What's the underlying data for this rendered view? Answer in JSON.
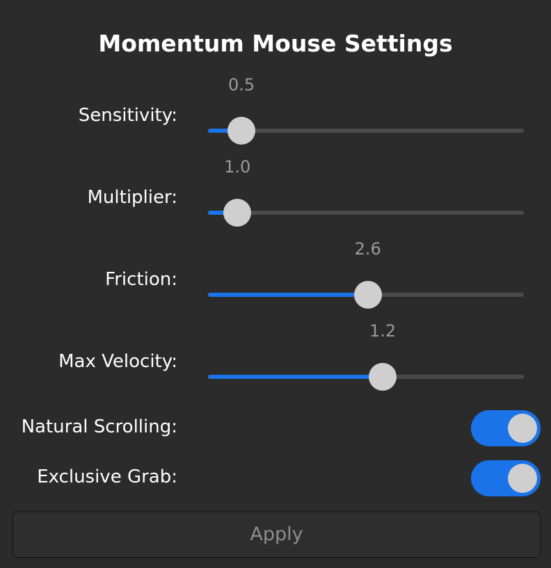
{
  "window": {
    "title": "Momentum Mouse Settings"
  },
  "sliders": [
    {
      "label": "Sensitivity:",
      "value_text": "0.5",
      "fill_fraction": 0.106
    },
    {
      "label": "Multiplier:",
      "value_text": "1.0",
      "fill_fraction": 0.093
    },
    {
      "label": "Friction:",
      "value_text": "2.6",
      "fill_fraction": 0.506
    },
    {
      "label": "Max Velocity:",
      "value_text": "1.2",
      "fill_fraction": 0.553
    }
  ],
  "toggles": [
    {
      "label": "Natural Scrolling:",
      "state": "on"
    },
    {
      "label": "Exclusive Grab:",
      "state": "on"
    }
  ],
  "apply_button": {
    "label": "Apply"
  },
  "colors": {
    "background": "#2b2b2b",
    "accent": "#1a73e8",
    "track": "#4a4a4a",
    "thumb": "#cfcfcf"
  }
}
